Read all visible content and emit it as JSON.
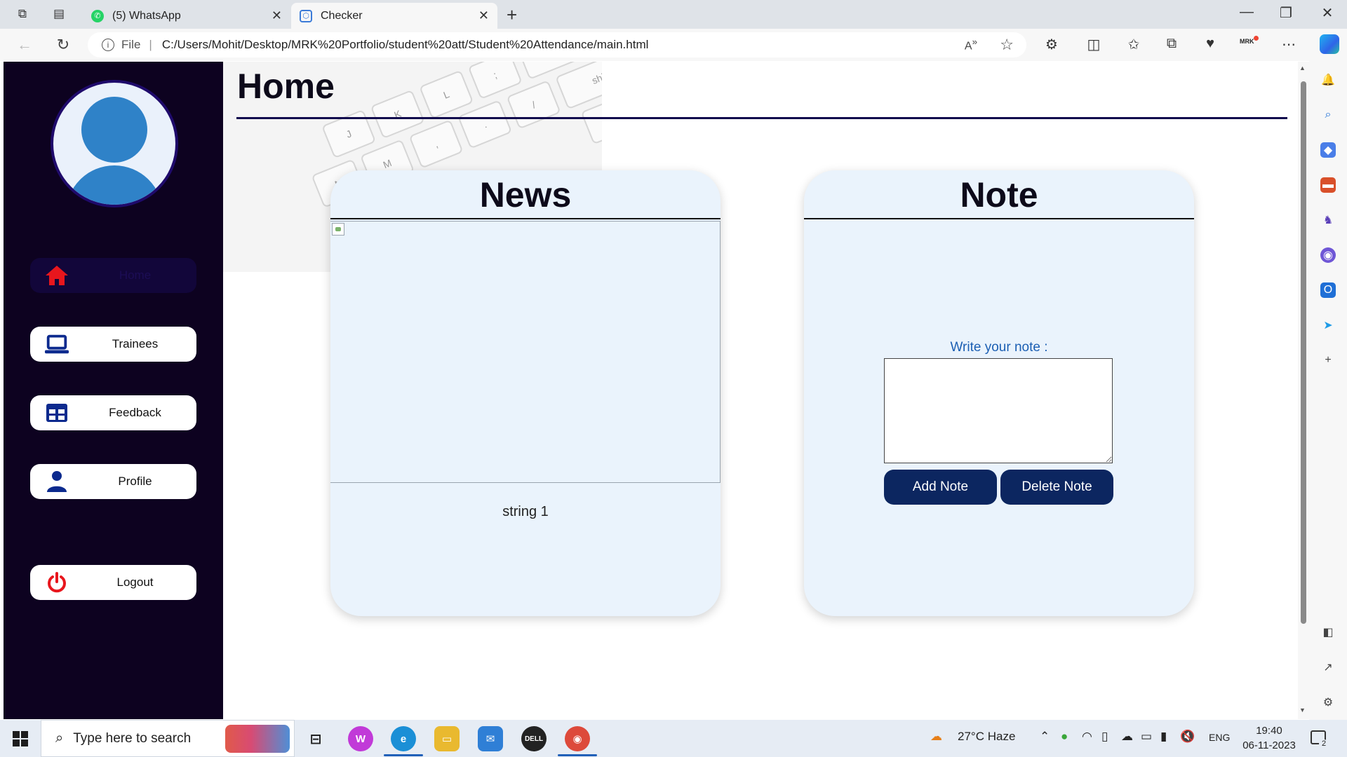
{
  "browser": {
    "tabs": [
      {
        "title": "(5) WhatsApp",
        "favicon": "whatsapp-icon"
      },
      {
        "title": "Checker",
        "favicon": "checker-icon"
      }
    ],
    "address": {
      "file_label": "File",
      "url": "C:/Users/Mohit/Desktop/MRK%20Portfolio/student%20att/Student%20Attendance/main.html"
    },
    "profile_initials": "MRK"
  },
  "sidebar": {
    "items": [
      {
        "label": "Home",
        "icon": "home-icon"
      },
      {
        "label": "Trainees",
        "icon": "laptop-icon"
      },
      {
        "label": "Feedback",
        "icon": "table-icon"
      },
      {
        "label": "Profile",
        "icon": "user-icon"
      },
      {
        "label": "Logout",
        "icon": "power-icon"
      }
    ]
  },
  "main": {
    "title": "Home",
    "news": {
      "title": "News",
      "text": "string 1"
    },
    "note": {
      "title": "Note",
      "label": "Write your note :",
      "value": "",
      "add_label": "Add Note",
      "delete_label": "Delete Note"
    }
  },
  "taskbar": {
    "search_placeholder": "Type here to search",
    "weather": "27°C  Haze",
    "language": "ENG",
    "time": "19:40",
    "date": "06-11-2023",
    "notification_count": "2"
  },
  "colors": {
    "sidebar_bg": "#0d0220",
    "card_bg": "#eaf3fc",
    "button_bg": "#0c2660",
    "note_label": "#1c5fb3",
    "home_icon": "#e8161d"
  }
}
